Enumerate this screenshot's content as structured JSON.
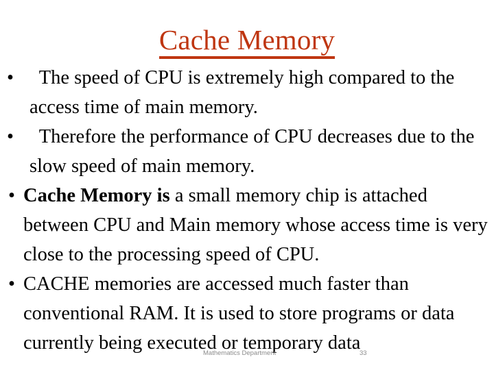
{
  "slide": {
    "title": "Cache Memory",
    "title_color": "#bf3611",
    "background_color": "#ffffff",
    "bullet_glyph": "•",
    "bullets": [
      {
        "lead_space": "  ",
        "bold_prefix": "",
        "text": "The speed of CPU is extremely high compared to the access time of main memory."
      },
      {
        "lead_space": "  ",
        "bold_prefix": "",
        "text": "Therefore the performance of CPU decreases due to the slow speed of main memory."
      },
      {
        "lead_space": "",
        "bold_prefix": "Cache Memory is",
        "text": " a small memory chip is attached between CPU and Main memory whose access time is very close to the processing speed of CPU."
      },
      {
        "lead_space": "",
        "bold_prefix": "",
        "text": "CACHE memories are accessed much faster than conventional RAM. It is used to store programs or data currently being executed or temporary data"
      }
    ]
  },
  "footer": {
    "label": "Mathematics Department",
    "page_number": "33",
    "color": "#8c8c8c"
  }
}
